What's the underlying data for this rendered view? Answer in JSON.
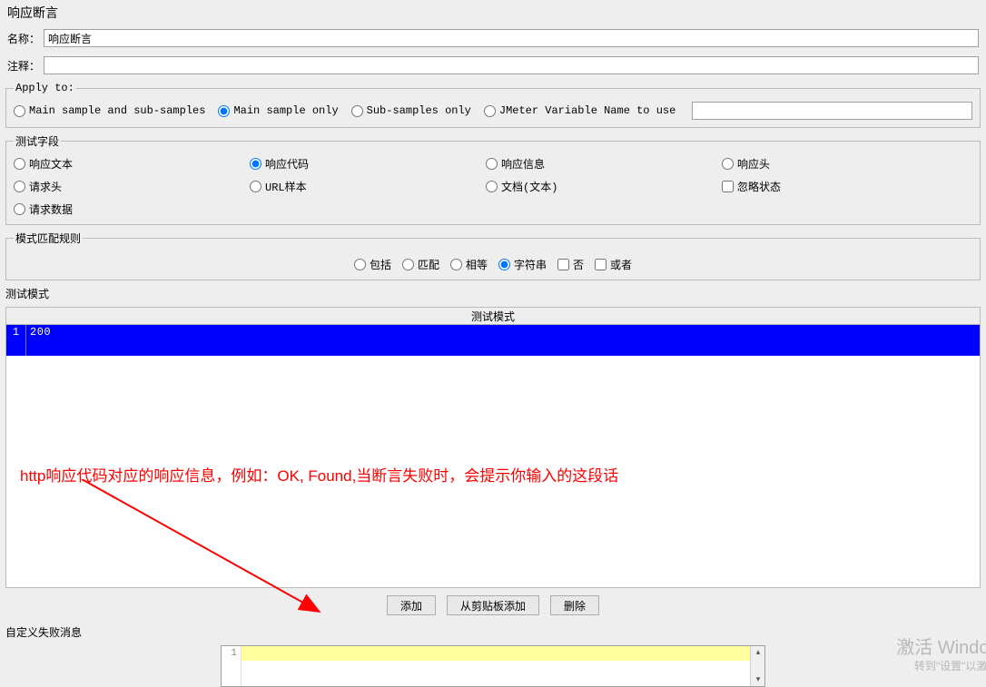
{
  "page_title": "响应断言",
  "name_label": "名称：",
  "name_value": "响应断言",
  "comment_label": "注释：",
  "comment_value": "",
  "apply_to": {
    "legend": "Apply to:",
    "options": [
      "Main sample and sub-samples",
      "Main sample only",
      "Sub-samples only",
      "JMeter Variable Name to use"
    ],
    "selected": 1,
    "var_value": ""
  },
  "test_field": {
    "legend": "测试字段",
    "options": [
      "响应文本",
      "响应代码",
      "响应信息",
      "响应头",
      "请求头",
      "URL样本",
      "文档(文本)",
      "请求数据"
    ],
    "selected": 1,
    "ignore_status": "忽略状态"
  },
  "match_rules": {
    "legend": "模式匹配规则",
    "options": [
      "包括",
      "匹配",
      "相等",
      "字符串"
    ],
    "selected": 3,
    "not_label": "否",
    "or_label": "或者"
  },
  "patterns": {
    "legend": "测试模式",
    "header": "测试模式",
    "rows": [
      {
        "index": "1",
        "value": "200"
      }
    ],
    "buttons": [
      "添加",
      "从剪贴板添加",
      "删除"
    ]
  },
  "fail_msg": {
    "legend": "自定义失败消息",
    "line_no": "1"
  },
  "annotation": "http响应代码对应的响应信息，例如：OK, Found,当断言失败时，会提示你输入的这段话",
  "watermark": {
    "line1": "激活 Windows",
    "line2": "转到\"设置\"以激活 W"
  }
}
